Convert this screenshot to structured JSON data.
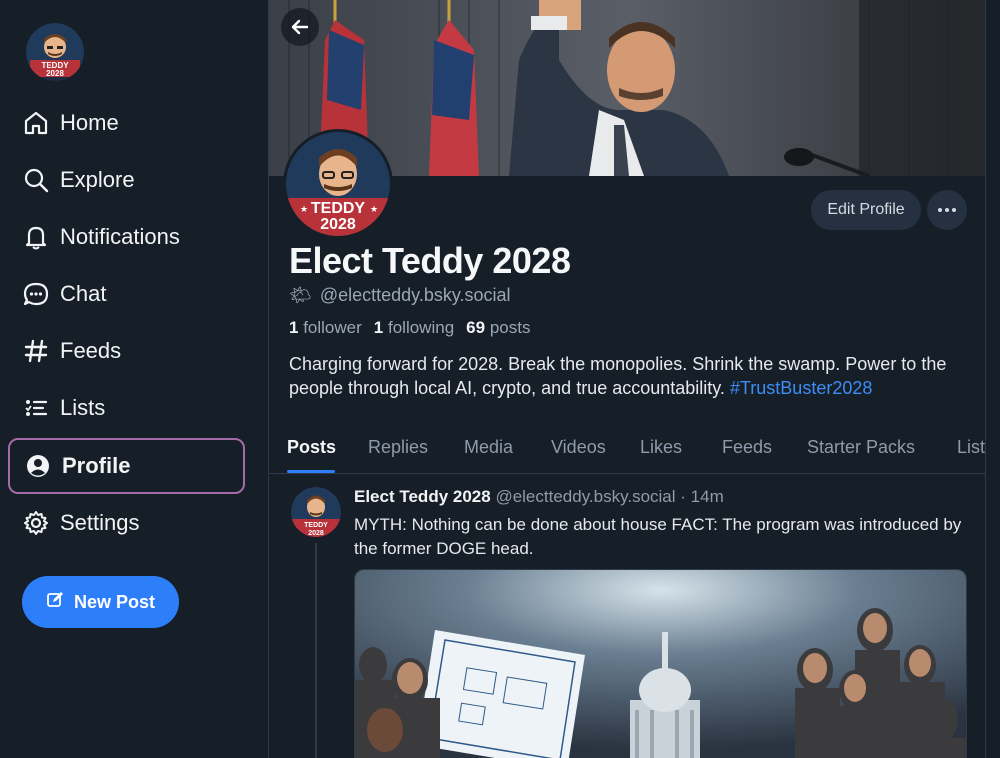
{
  "sidebar": {
    "items": [
      {
        "label": "Home",
        "icon": "home-icon"
      },
      {
        "label": "Explore",
        "icon": "search-icon"
      },
      {
        "label": "Notifications",
        "icon": "bell-icon"
      },
      {
        "label": "Chat",
        "icon": "chat-bubble-icon"
      },
      {
        "label": "Feeds",
        "icon": "hash-icon"
      },
      {
        "label": "Lists",
        "icon": "list-icon"
      },
      {
        "label": "Profile",
        "icon": "user-circle-icon",
        "active": true
      },
      {
        "label": "Settings",
        "icon": "gear-icon"
      }
    ],
    "new_post_label": "New Post"
  },
  "avatar_badge": {
    "line1": "TEDDY",
    "line2": "2028"
  },
  "profile": {
    "display_name": "Elect Teddy 2028",
    "handle": "@electteddy.bsky.social",
    "handle_emoji": "🌤",
    "followers_count": "1",
    "followers_label": "follower",
    "following_count": "1",
    "following_label": "following",
    "posts_count": "69",
    "posts_label": "posts",
    "bio": "Charging forward for 2028. Break the monopolies. Shrink the swamp. Power to the people through local AI, crypto, and true accountability.",
    "bio_hashtag": "#TrustBuster2028",
    "edit_profile_label": "Edit Profile",
    "more_label": "···"
  },
  "tabs": [
    "Posts",
    "Replies",
    "Media",
    "Videos",
    "Likes",
    "Feeds",
    "Starter Packs",
    "Lists"
  ],
  "active_tab": "Posts",
  "post": {
    "author": "Elect Teddy 2028",
    "handle": "@electteddy.bsky.social",
    "separator": "·",
    "time": "14m",
    "text": "MYTH: Nothing can be done about house FACT: The program was introduced by the former DOGE head."
  },
  "colors": {
    "background": "#161e27",
    "accent": "#2d7ff9",
    "hashtag": "#3d8df5",
    "active_outline": "#a46ba8",
    "muted_text": "#8f9bab"
  }
}
